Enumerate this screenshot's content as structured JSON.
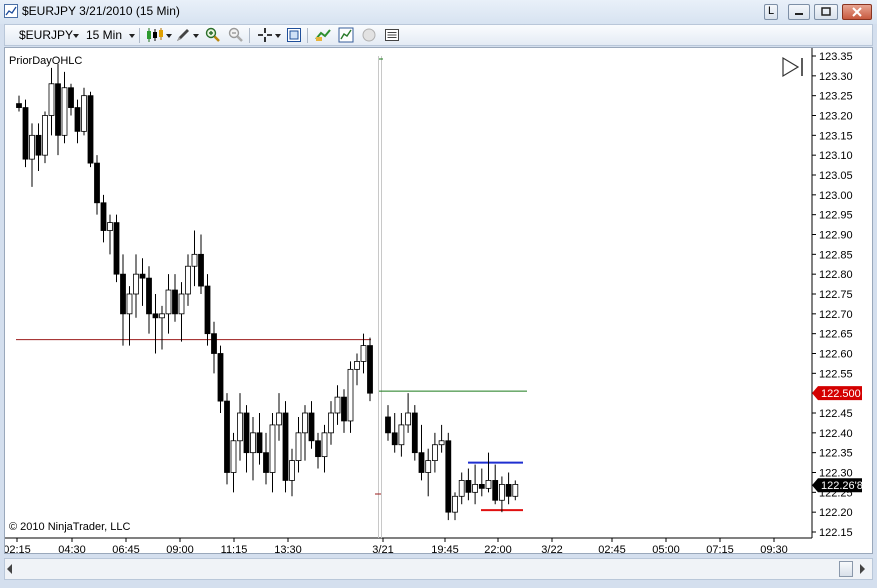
{
  "window": {
    "title": "$EURJPY  3/21/2010 (15 Min)",
    "controls": {
      "restore_label": "L"
    }
  },
  "toolbar": {
    "instrument": "$EURJPY",
    "interval": "15 Min"
  },
  "indicator_label": "PriorDayOHLC",
  "copyright": "© 2010 NinjaTrader, LLC",
  "colors": {
    "prior_day_high": "#9b1b1b",
    "prior_day_open": "#1a7a1a",
    "current_high": "#1f2fd0",
    "current_low": "#e01010",
    "price_marker_red": "#d40000",
    "price_marker_black": "#000000"
  },
  "chart_data": {
    "type": "candlestick",
    "x_tick_labels": [
      "02:15",
      "04:30",
      "06:45",
      "09:00",
      "11:15",
      "13:30",
      "3/21",
      "19:45",
      "22:00",
      "3/22",
      "02:45",
      "05:00",
      "07:15",
      "09:30"
    ],
    "y_tick_labels": [
      "123.35",
      "123.30",
      "123.25",
      "123.20",
      "123.15",
      "123.10",
      "123.05",
      "123.00",
      "122.95",
      "122.90",
      "122.85",
      "122.80",
      "122.75",
      "122.70",
      "122.65",
      "122.60",
      "122.55",
      "122.50",
      "122.45",
      "122.40",
      "122.35",
      "122.30",
      "122.25",
      "122.20",
      "122.15"
    ],
    "ylim": [
      122.15,
      123.35
    ],
    "price_markers": [
      {
        "label": "122.500",
        "value": 122.5,
        "color": "red"
      },
      {
        "label": "122.26'8",
        "value": 122.268,
        "color": "black"
      }
    ],
    "levels": [
      {
        "value": 122.635,
        "color": "darkred",
        "span": "prior-day"
      },
      {
        "value": 122.505,
        "color": "green",
        "span": "current-day"
      },
      {
        "value": 122.325,
        "color": "blue",
        "span": "current-day"
      },
      {
        "value": 122.205,
        "color": "red",
        "span": "current-day"
      }
    ],
    "session_break": "3/21",
    "candles": [
      [
        123.23,
        123.25,
        123.21,
        123.22
      ],
      [
        123.22,
        123.24,
        123.07,
        123.09
      ],
      [
        123.09,
        123.18,
        123.02,
        123.15
      ],
      [
        123.15,
        123.18,
        123.06,
        123.1
      ],
      [
        123.1,
        123.21,
        123.08,
        123.2
      ],
      [
        123.2,
        123.32,
        123.15,
        123.28
      ],
      [
        123.28,
        123.33,
        123.1,
        123.15
      ],
      [
        123.15,
        123.31,
        123.13,
        123.27
      ],
      [
        123.27,
        123.28,
        123.2,
        123.22
      ],
      [
        123.22,
        123.24,
        123.13,
        123.16
      ],
      [
        123.16,
        123.27,
        123.15,
        123.25
      ],
      [
        123.25,
        123.26,
        123.07,
        123.08
      ],
      [
        123.08,
        123.1,
        122.95,
        122.98
      ],
      [
        122.98,
        123.0,
        122.88,
        122.91
      ],
      [
        122.91,
        122.95,
        122.85,
        122.93
      ],
      [
        122.93,
        122.95,
        122.78,
        122.8
      ],
      [
        122.8,
        122.85,
        122.62,
        122.7
      ],
      [
        122.7,
        122.77,
        122.62,
        122.75
      ],
      [
        122.75,
        122.85,
        122.69,
        122.8
      ],
      [
        122.8,
        122.84,
        122.72,
        122.79
      ],
      [
        122.79,
        122.82,
        122.65,
        122.7
      ],
      [
        122.7,
        122.75,
        122.6,
        122.69
      ],
      [
        122.69,
        122.72,
        122.61,
        122.7
      ],
      [
        122.7,
        122.8,
        122.65,
        122.76
      ],
      [
        122.76,
        122.8,
        122.68,
        122.7
      ],
      [
        122.7,
        122.78,
        122.63,
        122.75
      ],
      [
        122.75,
        122.85,
        122.72,
        122.82
      ],
      [
        122.82,
        122.91,
        122.77,
        122.85
      ],
      [
        122.85,
        122.9,
        122.75,
        122.77
      ],
      [
        122.77,
        122.8,
        122.62,
        122.65
      ],
      [
        122.65,
        122.68,
        122.55,
        122.6
      ],
      [
        122.6,
        122.62,
        122.45,
        122.48
      ],
      [
        122.48,
        122.5,
        122.27,
        122.3
      ],
      [
        122.3,
        122.4,
        122.25,
        122.38
      ],
      [
        122.38,
        122.5,
        122.33,
        122.45
      ],
      [
        122.45,
        122.47,
        122.3,
        122.35
      ],
      [
        122.35,
        122.44,
        122.28,
        122.4
      ],
      [
        122.4,
        122.45,
        122.32,
        122.35
      ],
      [
        122.35,
        122.4,
        122.27,
        122.3
      ],
      [
        122.3,
        122.45,
        122.25,
        122.42
      ],
      [
        122.42,
        122.5,
        122.38,
        122.45
      ],
      [
        122.45,
        122.48,
        122.25,
        122.28
      ],
      [
        122.28,
        122.36,
        122.24,
        122.33
      ],
      [
        122.33,
        122.44,
        122.3,
        122.4
      ],
      [
        122.4,
        122.47,
        122.33,
        122.45
      ],
      [
        122.45,
        122.48,
        122.36,
        122.38
      ],
      [
        122.38,
        122.4,
        122.31,
        122.34
      ],
      [
        122.34,
        122.42,
        122.3,
        122.4
      ],
      [
        122.4,
        122.48,
        122.37,
        122.45
      ],
      [
        122.45,
        122.52,
        122.42,
        122.49
      ],
      [
        122.49,
        122.51,
        122.4,
        122.43
      ],
      [
        122.43,
        122.58,
        122.4,
        122.56
      ],
      [
        122.56,
        122.6,
        122.52,
        122.58
      ],
      [
        122.58,
        122.65,
        122.55,
        122.62
      ],
      [
        122.62,
        122.64,
        122.48,
        122.5
      ],
      [
        122.44,
        122.47,
        122.38,
        122.4
      ],
      [
        122.4,
        122.45,
        122.35,
        122.37
      ],
      [
        122.37,
        122.45,
        122.34,
        122.42
      ],
      [
        122.42,
        122.5,
        122.4,
        122.45
      ],
      [
        122.45,
        122.47,
        122.33,
        122.35
      ],
      [
        122.35,
        122.42,
        122.28,
        122.3
      ],
      [
        122.3,
        122.36,
        122.24,
        122.33
      ],
      [
        122.33,
        122.4,
        122.3,
        122.37
      ],
      [
        122.37,
        122.42,
        122.35,
        122.38
      ],
      [
        122.38,
        122.4,
        122.18,
        122.2
      ],
      [
        122.2,
        122.25,
        122.18,
        122.24
      ],
      [
        122.24,
        122.3,
        122.22,
        122.28
      ],
      [
        122.28,
        122.31,
        122.23,
        122.25
      ],
      [
        122.25,
        122.32,
        122.22,
        122.27
      ],
      [
        122.27,
        122.31,
        122.24,
        122.26
      ],
      [
        122.26,
        122.35,
        122.25,
        122.28
      ],
      [
        122.28,
        122.32,
        122.22,
        122.23
      ],
      [
        122.23,
        122.29,
        122.2,
        122.27
      ],
      [
        122.27,
        122.3,
        122.22,
        122.24
      ],
      [
        122.24,
        122.28,
        122.23,
        122.27
      ]
    ]
  }
}
